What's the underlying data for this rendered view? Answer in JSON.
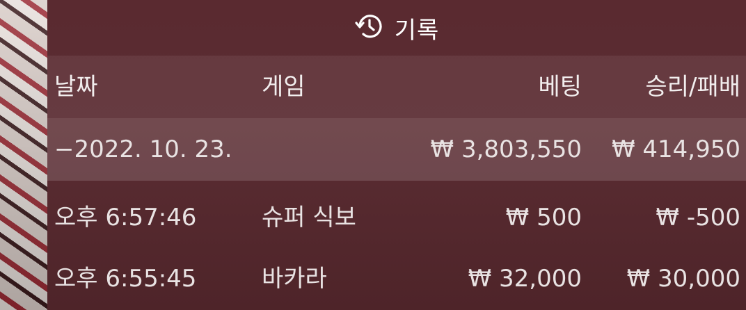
{
  "title": {
    "icon": "history-icon",
    "text": "기록"
  },
  "table": {
    "headers": {
      "date": "날짜",
      "game": "게임",
      "bet": "베팅",
      "result": "승리/패배"
    },
    "date_group": {
      "label": "−2022. 10. 23.",
      "bet": "₩ 3,803,550",
      "result": "₩ 414,950"
    },
    "rows": [
      {
        "time": "오후 6:57:46",
        "game": "슈퍼 식보",
        "bet": "₩ 500",
        "result": "₩ -500"
      },
      {
        "time": "오후 6:55:45",
        "game": "바카라",
        "bet": "₩ 32,000",
        "result": "₩ 30,000"
      }
    ]
  }
}
